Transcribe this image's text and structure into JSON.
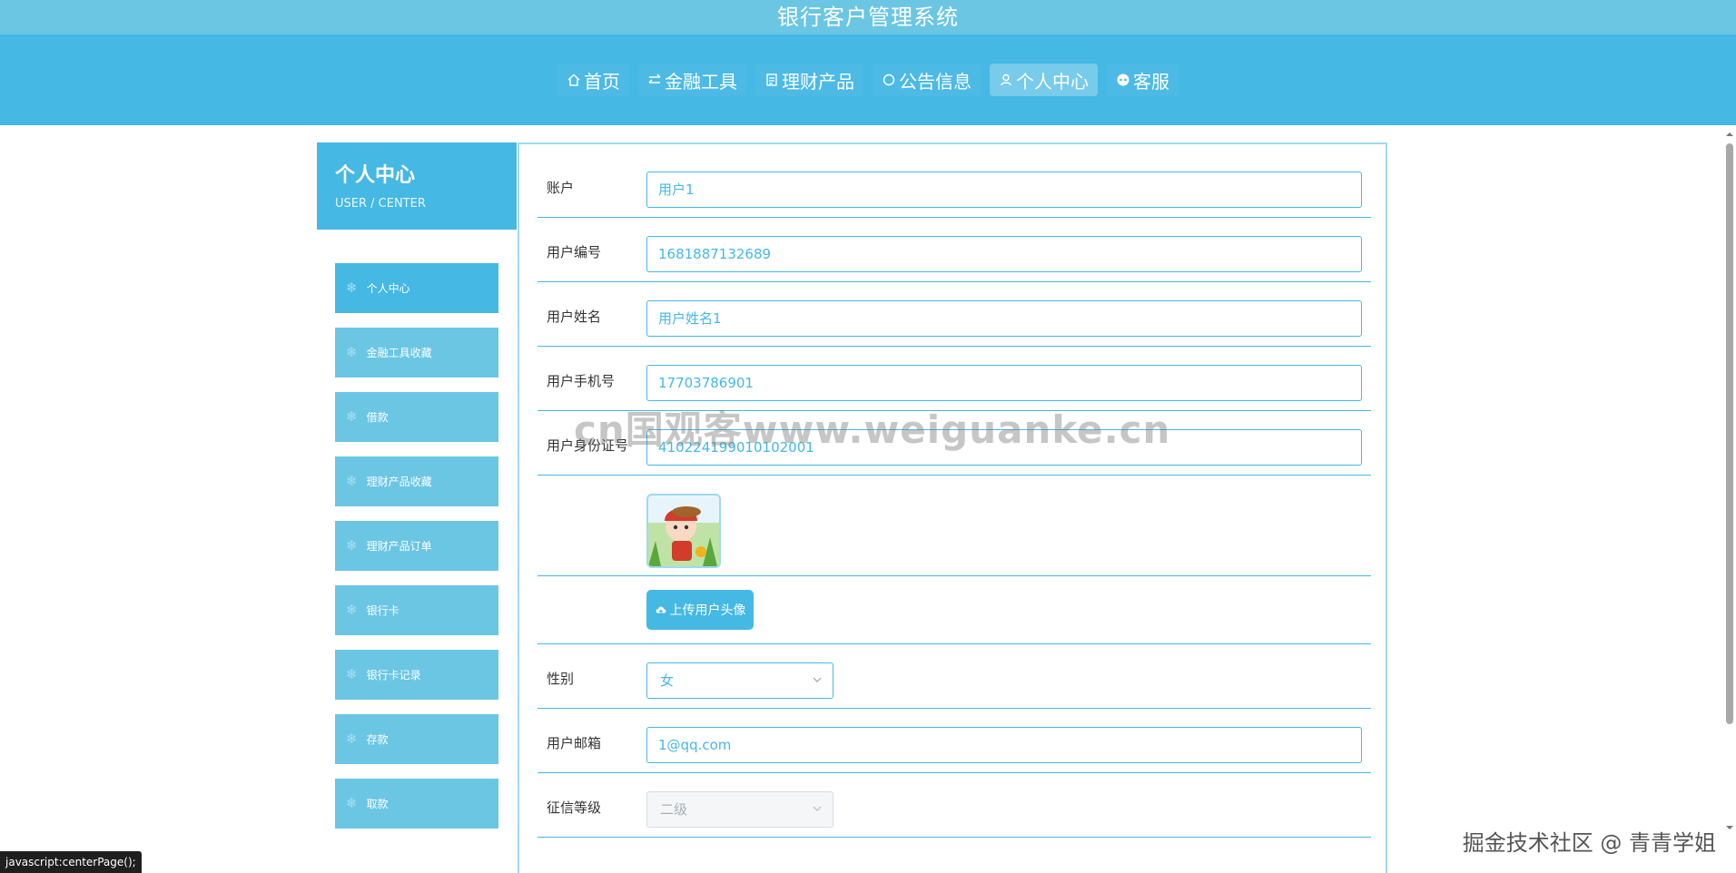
{
  "app_title": "银行客户管理系统",
  "nav": [
    {
      "label": "首页",
      "icon": "home-icon",
      "active": false
    },
    {
      "label": "金融工具",
      "icon": "exchange-icon",
      "active": false
    },
    {
      "label": "理财产品",
      "icon": "document-icon",
      "active": false
    },
    {
      "label": "公告信息",
      "icon": "info-circle-icon",
      "active": false
    },
    {
      "label": "个人中心",
      "icon": "user-icon",
      "active": true
    },
    {
      "label": "客服",
      "icon": "chat-icon",
      "active": false
    }
  ],
  "sidebar": {
    "title": "个人中心",
    "subtitle": "USER / CENTER",
    "items": [
      {
        "label": "个人中心",
        "active": true
      },
      {
        "label": "金融工具收藏",
        "active": false
      },
      {
        "label": "借款",
        "active": false
      },
      {
        "label": "理财产品收藏",
        "active": false
      },
      {
        "label": "理财产品订单",
        "active": false
      },
      {
        "label": "银行卡",
        "active": false
      },
      {
        "label": "银行卡记录",
        "active": false
      },
      {
        "label": "存款",
        "active": false
      },
      {
        "label": "取款",
        "active": false
      }
    ]
  },
  "form": {
    "account_label": "账户",
    "account_value": "用户1",
    "user_no_label": "用户编号",
    "user_no_value": "1681887132689",
    "user_name_label": "用户姓名",
    "user_name_value": "用户姓名1",
    "phone_label": "用户手机号",
    "phone_value": "17703786901",
    "id_label": "用户身份证号",
    "id_value": "410224199010102001",
    "upload_label": "上传用户头像",
    "gender_label": "性别",
    "gender_value": "女",
    "email_label": "用户邮箱",
    "email_value": "1@qq.com",
    "credit_label": "征信等级",
    "credit_value": "二级"
  },
  "watermark_center": "cn国观客www.weiguanke.cn",
  "watermark_corner": "掘金技术社区 @ 青青学姐",
  "status_bar": "javascript:centerPage();",
  "colors": {
    "title_bar": "#6bc6e4",
    "nav_band": "#45b8e4",
    "accent": "#45b8e4",
    "sidebar_item": "#6bc6e4"
  }
}
